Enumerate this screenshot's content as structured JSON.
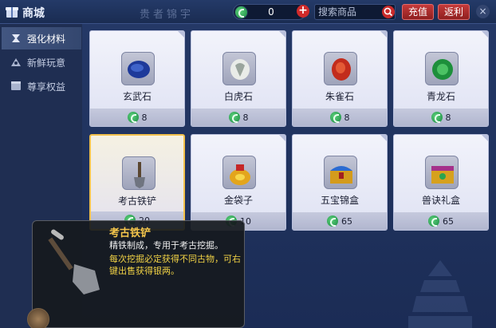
{
  "header": {
    "title": "商城",
    "watermark": "贵者锦宇",
    "currency_value": "0",
    "plus_label": "+",
    "search_placeholder": "搜索商品",
    "recharge_label": "充值",
    "rebate_label": "返利",
    "close_label": "×"
  },
  "sidebar": {
    "items": [
      {
        "label": "强化材料",
        "icon": "enhance-icon",
        "active": true
      },
      {
        "label": "新鲜玩意",
        "icon": "novelty-icon",
        "active": false
      },
      {
        "label": "尊享权益",
        "icon": "privilege-icon",
        "active": false
      }
    ]
  },
  "shop": {
    "items": [
      {
        "name": "玄武石",
        "price": "8",
        "icon": "xuanwu-stone-icon"
      },
      {
        "name": "白虎石",
        "price": "8",
        "icon": "baihu-stone-icon"
      },
      {
        "name": "朱雀石",
        "price": "8",
        "icon": "zhuque-stone-icon"
      },
      {
        "name": "青龙石",
        "price": "8",
        "icon": "qinglong-stone-icon"
      },
      {
        "name": "考古铁铲",
        "price": "20",
        "icon": "shovel-icon",
        "selected": true
      },
      {
        "name": "金袋子",
        "price": "10",
        "icon": "gold-bag-icon"
      },
      {
        "name": "五宝锦盒",
        "price": "65",
        "icon": "treasure-box-icon"
      },
      {
        "name": "兽诀礼盒",
        "price": "65",
        "icon": "gift-box-icon"
      }
    ]
  },
  "tooltip": {
    "name": "考古铁铲",
    "description": "精铁制成，专用于考古挖掘。",
    "effect": "每次挖掘必定获得不同古物，可右键出售获得银两。",
    "icon": "shovel-icon"
  },
  "colors": {
    "accent_gold": "#f5c64c",
    "button_red": "#c53a3a",
    "coin_green": "#1a8a43"
  }
}
